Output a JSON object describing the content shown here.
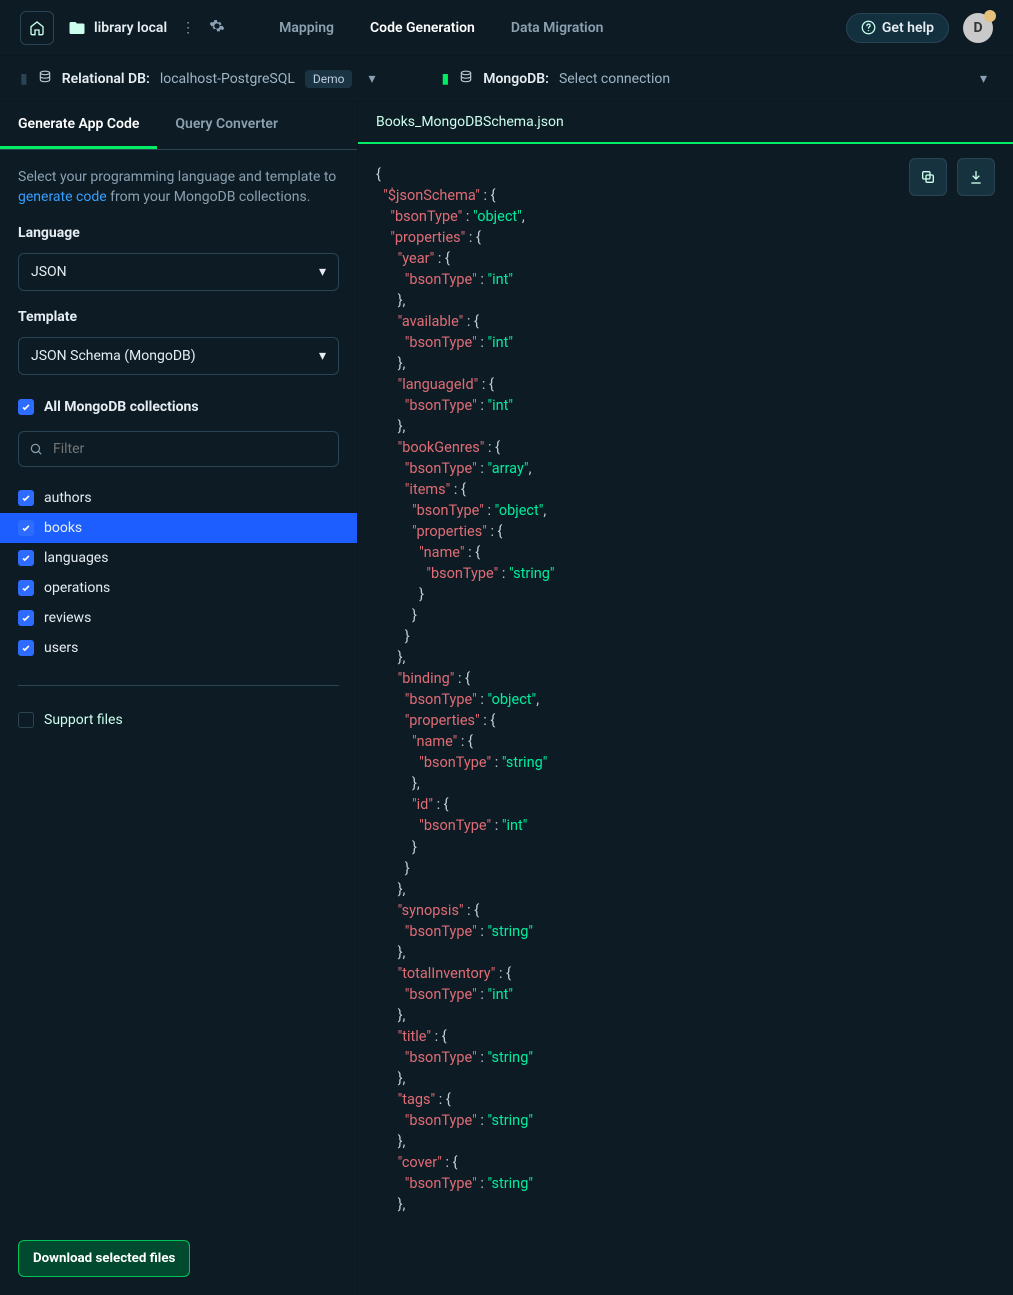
{
  "topbar": {
    "project_name": "library local",
    "nav": [
      "Mapping",
      "Code Generation",
      "Data Migration"
    ],
    "active_nav": 1,
    "help": "Get help",
    "avatar_letter": "D"
  },
  "connbar": {
    "rel_label": "Relational DB:",
    "rel_conn": "localhost-PostgreSQL",
    "rel_badge": "Demo",
    "mdb_label": "MongoDB:",
    "mdb_conn": "Select connection"
  },
  "side": {
    "tabs": [
      "Generate App Code",
      "Query Converter"
    ],
    "active_tab": 0,
    "intro_pre": "Select your programming language and template to ",
    "intro_link": "generate code",
    "intro_post": " from your MongoDB collections.",
    "language_label": "Language",
    "language_value": "JSON",
    "template_label": "Template",
    "template_value": "JSON Schema (MongoDB)",
    "all_label": "All MongoDB collections",
    "all_checked": true,
    "filter_placeholder": "Filter",
    "collections": [
      {
        "name": "authors",
        "checked": true,
        "selected": false
      },
      {
        "name": "books",
        "checked": true,
        "selected": true
      },
      {
        "name": "languages",
        "checked": true,
        "selected": false
      },
      {
        "name": "operations",
        "checked": true,
        "selected": false
      },
      {
        "name": "reviews",
        "checked": true,
        "selected": false
      },
      {
        "name": "users",
        "checked": true,
        "selected": false
      }
    ],
    "support_label": "Support files",
    "support_checked": false,
    "download": "Download selected files"
  },
  "editor": {
    "filename": "Books_MongoDBSchema.json",
    "lines": [
      [
        [
          "p",
          "{"
        ]
      ],
      [
        [
          "p",
          "  "
        ],
        [
          "k",
          "\"$jsonSchema\""
        ],
        [
          "p",
          " : {"
        ]
      ],
      [
        [
          "p",
          "    "
        ],
        [
          "k",
          "\"bsonType\""
        ],
        [
          "p",
          " : "
        ],
        [
          "s",
          "\"object\""
        ],
        [
          "p",
          ","
        ]
      ],
      [
        [
          "p",
          "    "
        ],
        [
          "k",
          "\"properties\""
        ],
        [
          "p",
          " : {"
        ]
      ],
      [
        [
          "p",
          "      "
        ],
        [
          "k",
          "\"year\""
        ],
        [
          "p",
          " : {"
        ]
      ],
      [
        [
          "p",
          "        "
        ],
        [
          "k",
          "\"bsonType\""
        ],
        [
          "p",
          " : "
        ],
        [
          "s",
          "\"int\""
        ]
      ],
      [
        [
          "p",
          "      },"
        ]
      ],
      [
        [
          "p",
          "      "
        ],
        [
          "k",
          "\"available\""
        ],
        [
          "p",
          " : {"
        ]
      ],
      [
        [
          "p",
          "        "
        ],
        [
          "k",
          "\"bsonType\""
        ],
        [
          "p",
          " : "
        ],
        [
          "s",
          "\"int\""
        ]
      ],
      [
        [
          "p",
          "      },"
        ]
      ],
      [
        [
          "p",
          "      "
        ],
        [
          "k",
          "\"languageId\""
        ],
        [
          "p",
          " : {"
        ]
      ],
      [
        [
          "p",
          "        "
        ],
        [
          "k",
          "\"bsonType\""
        ],
        [
          "p",
          " : "
        ],
        [
          "s",
          "\"int\""
        ]
      ],
      [
        [
          "p",
          "      },"
        ]
      ],
      [
        [
          "p",
          "      "
        ],
        [
          "k",
          "\"bookGenres\""
        ],
        [
          "p",
          " : {"
        ]
      ],
      [
        [
          "p",
          "        "
        ],
        [
          "k",
          "\"bsonType\""
        ],
        [
          "p",
          " : "
        ],
        [
          "s",
          "\"array\""
        ],
        [
          "p",
          ","
        ]
      ],
      [
        [
          "p",
          "        "
        ],
        [
          "k",
          "\"items\""
        ],
        [
          "p",
          " : {"
        ]
      ],
      [
        [
          "p",
          "          "
        ],
        [
          "k",
          "\"bsonType\""
        ],
        [
          "p",
          " : "
        ],
        [
          "s",
          "\"object\""
        ],
        [
          "p",
          ","
        ]
      ],
      [
        [
          "p",
          "          "
        ],
        [
          "k",
          "\"properties\""
        ],
        [
          "p",
          " : {"
        ]
      ],
      [
        [
          "p",
          "            "
        ],
        [
          "k",
          "\"name\""
        ],
        [
          "p",
          " : {"
        ]
      ],
      [
        [
          "p",
          "              "
        ],
        [
          "k",
          "\"bsonType\""
        ],
        [
          "p",
          " : "
        ],
        [
          "s",
          "\"string\""
        ]
      ],
      [
        [
          "p",
          "            }"
        ]
      ],
      [
        [
          "p",
          "          }"
        ]
      ],
      [
        [
          "p",
          "        }"
        ]
      ],
      [
        [
          "p",
          "      },"
        ]
      ],
      [
        [
          "p",
          "      "
        ],
        [
          "k",
          "\"binding\""
        ],
        [
          "p",
          " : {"
        ]
      ],
      [
        [
          "p",
          "        "
        ],
        [
          "k",
          "\"bsonType\""
        ],
        [
          "p",
          " : "
        ],
        [
          "s",
          "\"object\""
        ],
        [
          "p",
          ","
        ]
      ],
      [
        [
          "p",
          "        "
        ],
        [
          "k",
          "\"properties\""
        ],
        [
          "p",
          " : {"
        ]
      ],
      [
        [
          "p",
          "          "
        ],
        [
          "k",
          "\"name\""
        ],
        [
          "p",
          " : {"
        ]
      ],
      [
        [
          "p",
          "            "
        ],
        [
          "k",
          "\"bsonType\""
        ],
        [
          "p",
          " : "
        ],
        [
          "s",
          "\"string\""
        ]
      ],
      [
        [
          "p",
          "          },"
        ]
      ],
      [
        [
          "p",
          "          "
        ],
        [
          "k",
          "\"id\""
        ],
        [
          "p",
          " : {"
        ]
      ],
      [
        [
          "p",
          "            "
        ],
        [
          "k",
          "\"bsonType\""
        ],
        [
          "p",
          " : "
        ],
        [
          "s",
          "\"int\""
        ]
      ],
      [
        [
          "p",
          "          }"
        ]
      ],
      [
        [
          "p",
          "        }"
        ]
      ],
      [
        [
          "p",
          "      },"
        ]
      ],
      [
        [
          "p",
          "      "
        ],
        [
          "k",
          "\"synopsis\""
        ],
        [
          "p",
          " : {"
        ]
      ],
      [
        [
          "p",
          "        "
        ],
        [
          "k",
          "\"bsonType\""
        ],
        [
          "p",
          " : "
        ],
        [
          "s",
          "\"string\""
        ]
      ],
      [
        [
          "p",
          "      },"
        ]
      ],
      [
        [
          "p",
          "      "
        ],
        [
          "k",
          "\"totalInventory\""
        ],
        [
          "p",
          " : {"
        ]
      ],
      [
        [
          "p",
          "        "
        ],
        [
          "k",
          "\"bsonType\""
        ],
        [
          "p",
          " : "
        ],
        [
          "s",
          "\"int\""
        ]
      ],
      [
        [
          "p",
          "      },"
        ]
      ],
      [
        [
          "p",
          "      "
        ],
        [
          "k",
          "\"title\""
        ],
        [
          "p",
          " : {"
        ]
      ],
      [
        [
          "p",
          "        "
        ],
        [
          "k",
          "\"bsonType\""
        ],
        [
          "p",
          " : "
        ],
        [
          "s",
          "\"string\""
        ]
      ],
      [
        [
          "p",
          "      },"
        ]
      ],
      [
        [
          "p",
          "      "
        ],
        [
          "k",
          "\"tags\""
        ],
        [
          "p",
          " : {"
        ]
      ],
      [
        [
          "p",
          "        "
        ],
        [
          "k",
          "\"bsonType\""
        ],
        [
          "p",
          " : "
        ],
        [
          "s",
          "\"string\""
        ]
      ],
      [
        [
          "p",
          "      },"
        ]
      ],
      [
        [
          "p",
          "      "
        ],
        [
          "k",
          "\"cover\""
        ],
        [
          "p",
          " : {"
        ]
      ],
      [
        [
          "p",
          "        "
        ],
        [
          "k",
          "\"bsonType\""
        ],
        [
          "p",
          " : "
        ],
        [
          "s",
          "\"string\""
        ]
      ],
      [
        [
          "p",
          "      },"
        ]
      ]
    ]
  }
}
